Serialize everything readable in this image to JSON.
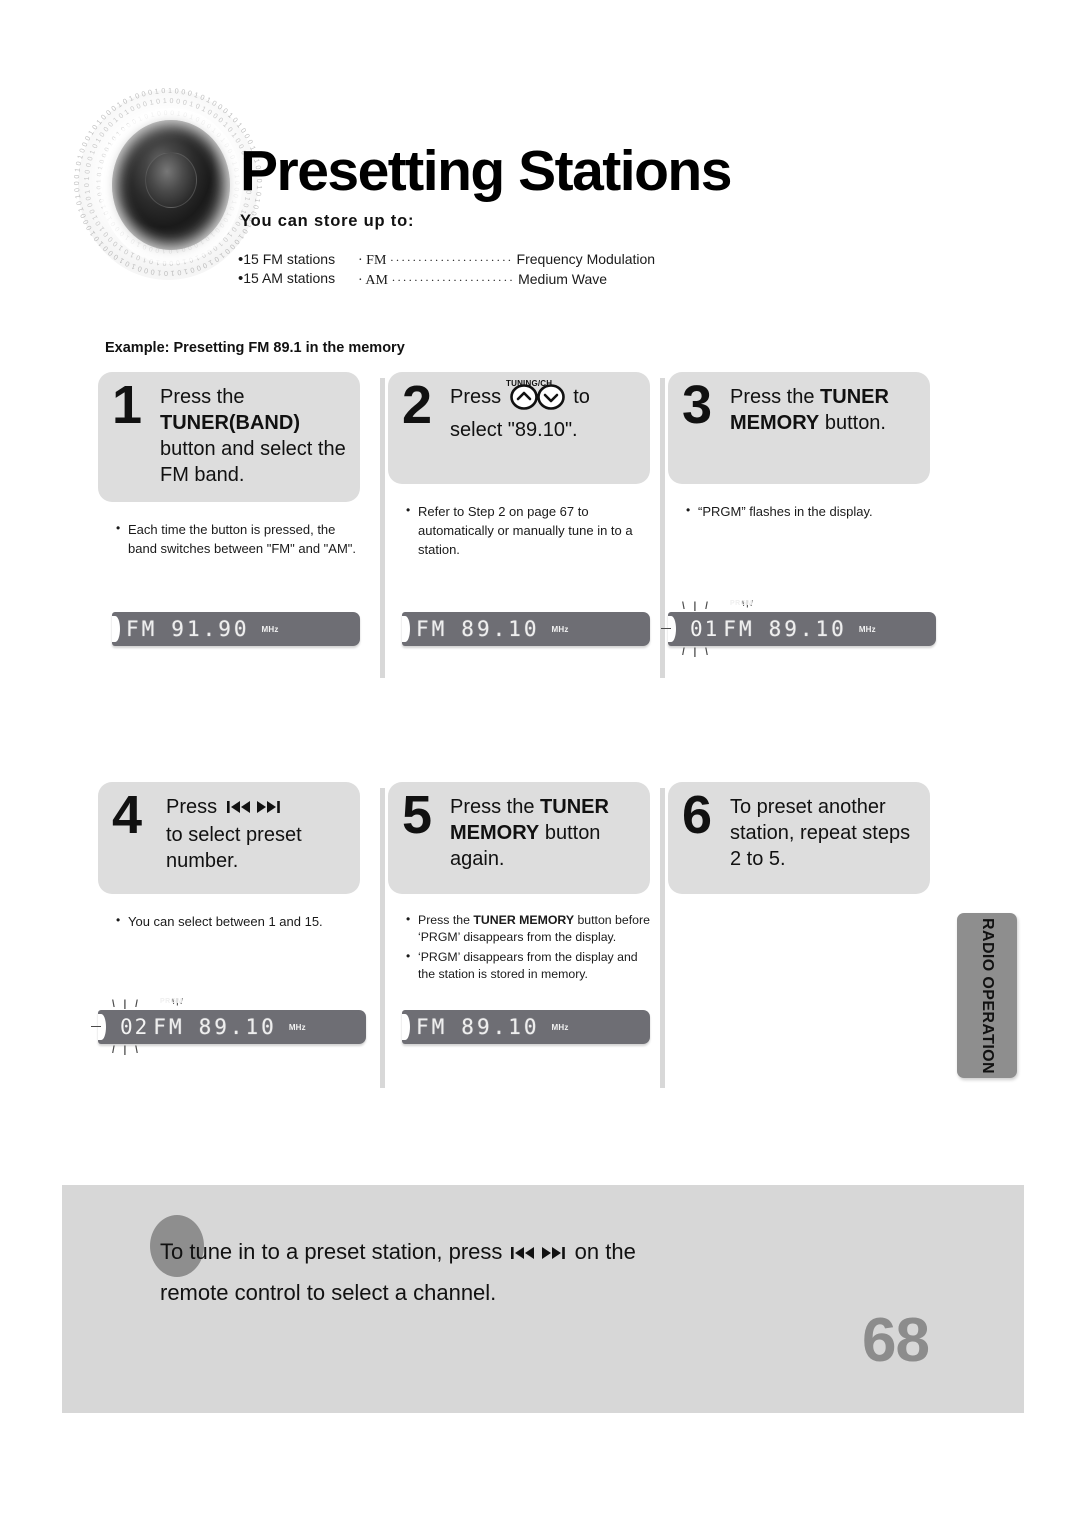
{
  "header": {
    "title": "Presetting Stations",
    "store_heading": "You can store up to:",
    "store_items": [
      {
        "label": "15 FM stations"
      },
      {
        "label": "15 AM stations"
      }
    ],
    "abbreviations": [
      {
        "term": "FM",
        "leader": "······················",
        "meaning": "Frequency Modulation"
      },
      {
        "term": "AM",
        "leader": "······················",
        "meaning": "Medium Wave"
      }
    ],
    "example": "Example: Presetting FM 89.1 in the memory",
    "logo_icon": "speaker-binary-logo"
  },
  "steps": [
    {
      "number": "1",
      "text_parts": [
        {
          "t": "Press the",
          "bold": false
        },
        {
          "t": "TUNER(BAND)",
          "bold": true
        },
        {
          "t": "button  and select the FM band.",
          "bold": false
        }
      ],
      "notes": [
        "Each time the button is pressed, the band switches between \"FM\" and \"AM\"."
      ],
      "display": {
        "band": "FM",
        "frequency": "91.90",
        "unit": "MHz",
        "preset": "",
        "prgm": false,
        "flashing": false
      }
    },
    {
      "number": "2",
      "text_prefix": "Press",
      "text_suffix": "to",
      "text_line2": "select \"89.10\".",
      "button_label": "TUNING/CH",
      "buttons": [
        "chevron-up-icon",
        "chevron-down-icon"
      ],
      "notes": [
        "Refer to Step 2 on page 67 to automatically or manually tune in to a station."
      ],
      "display": {
        "band": "FM",
        "frequency": "89.10",
        "unit": "MHz",
        "preset": "",
        "prgm": false,
        "flashing": false
      }
    },
    {
      "number": "3",
      "text_parts": [
        {
          "t": "Press the",
          "bold": false
        },
        {
          "t": "TUNER MEMORY",
          "bold": true
        },
        {
          "t": "button.",
          "bold": false
        }
      ],
      "notes": [
        "“PRGM” flashes in the display."
      ],
      "display": {
        "band": "FM",
        "frequency": "89.10",
        "unit": "MHz",
        "preset": "01",
        "prgm_label": "PRGM",
        "prgm": true,
        "flashing": true
      }
    },
    {
      "number": "4",
      "text_prefix": "Press",
      "text_line2": "to select preset number.",
      "buttons": [
        "skip-back-icon",
        "skip-forward-icon"
      ],
      "notes": [
        "You can select between 1 and 15."
      ],
      "display": {
        "band": "FM",
        "frequency": "89.10",
        "unit": "MHz",
        "preset": "02",
        "prgm_label": "PRGM",
        "prgm": true,
        "flashing": true
      }
    },
    {
      "number": "5",
      "text_parts": [
        {
          "t": "Press the",
          "bold": false
        },
        {
          "t": "TUNER MEMORY",
          "bold": true
        },
        {
          "t": "button again.",
          "bold": false
        }
      ],
      "notes": [
        "Press the TUNER MEMORY button before ‘PRGM’ disappears from the display.",
        "‘PRGM’ disappears from the display and the station is stored in memory."
      ],
      "display": {
        "band": "FM",
        "frequency": "89.10",
        "unit": "MHz",
        "preset": "",
        "prgm": false,
        "flashing": false
      }
    },
    {
      "number": "6",
      "text_plain": "To preset another station, repeat steps 2 to 5.",
      "notes": [],
      "display": null
    }
  ],
  "side_tab": {
    "label": "RADIO OPERATION"
  },
  "footer": {
    "line1_before": "To tune in to a preset station, press",
    "line1_after": "on the",
    "line2": "remote control to select a channel."
  },
  "page_number": "68",
  "colors": {
    "step_box": "#dddddd",
    "footer_bg": "#d7d7d7",
    "side_tab": "#8e8e8e",
    "lcd_bg": "#6e6e74",
    "page_number": "#8c8c8c"
  },
  "step5_note_bold": "TUNER MEMORY"
}
